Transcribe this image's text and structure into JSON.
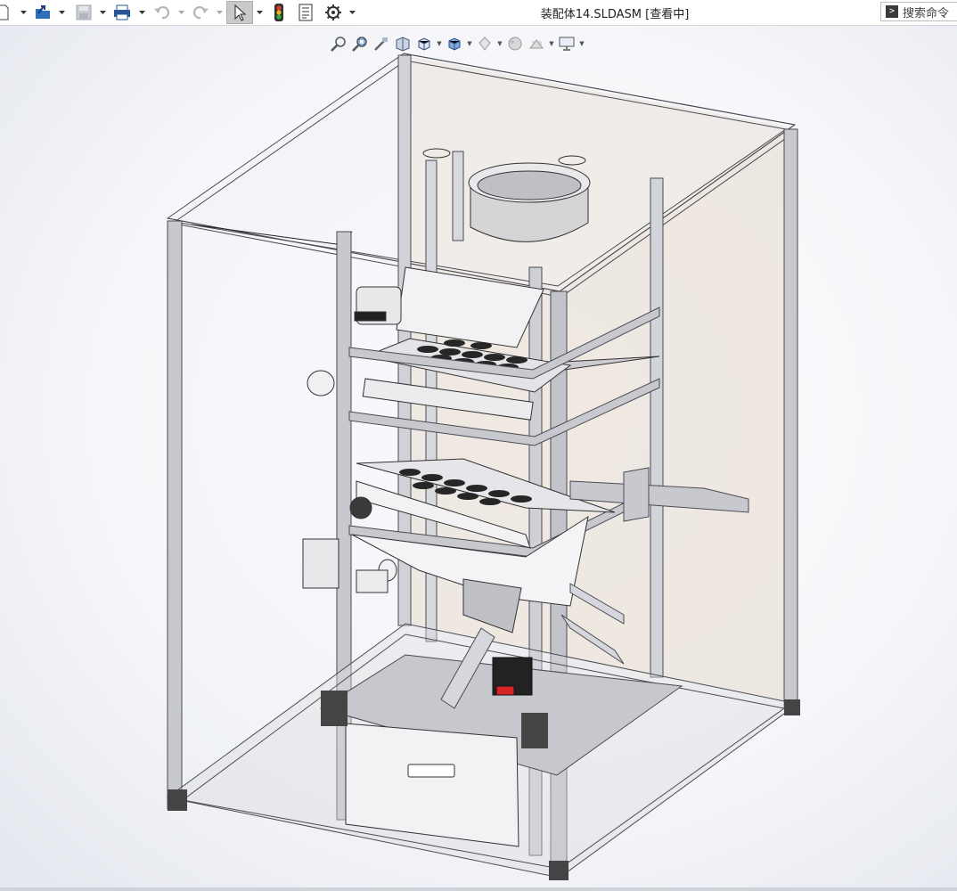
{
  "window": {
    "document_title": "装配体14.SLDASM [查看中]"
  },
  "search": {
    "placeholder": "搜索命令",
    "icon": "terminal-icon"
  },
  "toolbar": {
    "items": [
      "new-document-icon",
      "open-icon",
      "save-icon",
      "print-icon",
      "undo-icon",
      "redo-icon",
      "select-pointer-icon",
      "traffic-light-icon",
      "file-properties-icon",
      "options-gear-icon"
    ],
    "selected": "select-pointer-icon"
  },
  "heads_up_toolbar": {
    "items": [
      "zoom-to-fit-icon",
      "zoom-to-area-icon",
      "previous-view-icon",
      "section-view-icon",
      "view-orientation-icon",
      "display-style-icon",
      "hide-show-items-icon",
      "edit-appearance-icon",
      "apply-scene-icon",
      "view-settings-icon"
    ]
  },
  "viewport": {
    "content": "3D assembly model of aluminium-profile frame machine with hopper, sieve trays and drawer",
    "colors": {
      "frame": "#c3c4c9",
      "frame_dark": "#4a4a52",
      "panel_back": "#e9e1d8",
      "hopper": "#d5d5d8",
      "motor": "#222222",
      "motor_accent": "#d62424"
    }
  }
}
